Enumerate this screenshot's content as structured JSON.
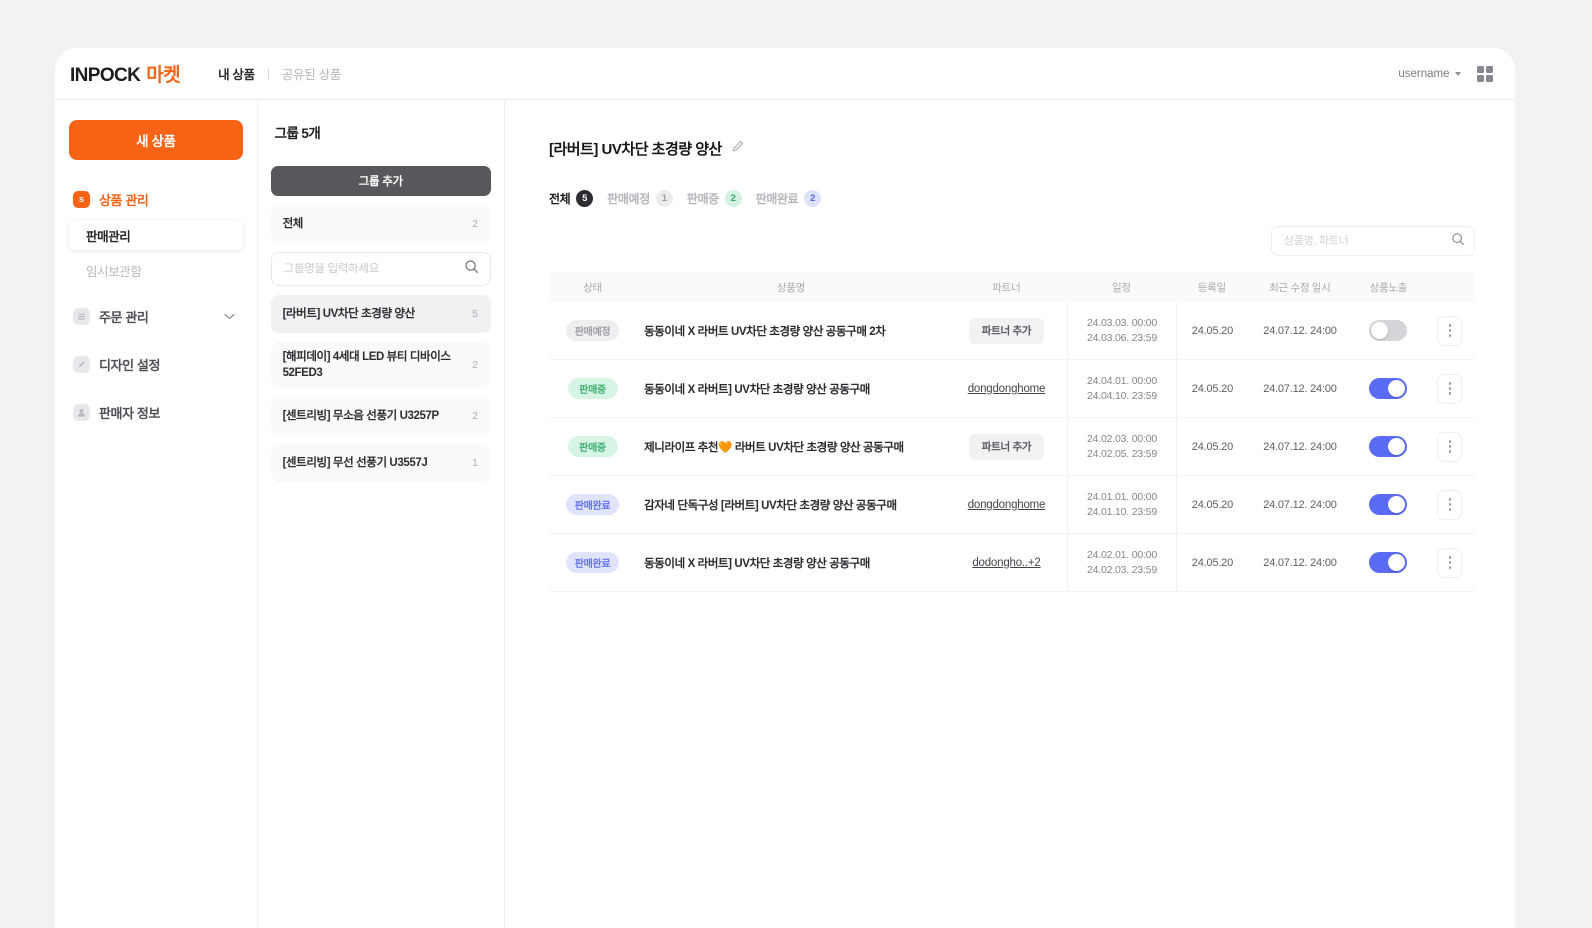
{
  "header": {
    "logo_main": "INPOCK",
    "logo_sub": "마켓",
    "nav": [
      {
        "label": "내 상품",
        "active": true
      },
      {
        "label": "공유된 상품",
        "active": false
      }
    ],
    "username": "username"
  },
  "sidebar": {
    "new_product_label": "새 상품",
    "items": [
      {
        "label": "상품 관리",
        "icon": "coin-icon",
        "active": true
      },
      {
        "label": "주문 관리",
        "icon": "list-icon",
        "active": false,
        "expandable": true
      },
      {
        "label": "디자인 설정",
        "icon": "brush-icon",
        "active": false
      },
      {
        "label": "판매자 정보",
        "icon": "person-icon",
        "active": false
      }
    ],
    "sub_items": [
      {
        "label": "판매관리",
        "selected": true
      },
      {
        "label": "임시보관함",
        "selected": false
      }
    ]
  },
  "groups": {
    "title": "그룹",
    "count_label": "5개",
    "add_button": "그룹 추가",
    "all_item": {
      "name": "전체",
      "count": "2"
    },
    "search_placeholder": "그룹명을 입력하세요",
    "search_value": "",
    "items": [
      {
        "name": "[라버트] UV차단 초경량 양산",
        "count": "5",
        "selected": true
      },
      {
        "name": "[해피데이] 4세대 LED 뷰티 디바이스 52FED3",
        "count": "2",
        "selected": false
      },
      {
        "name": "[센트리빙] 무소음 선풍기 U3257P",
        "count": "2",
        "selected": false
      },
      {
        "name": "[센트리빙] 무선 선풍기 U3557J",
        "count": "1",
        "selected": false
      }
    ]
  },
  "main": {
    "page_title": "[라버트] UV차단 초경량 양산",
    "tabs": [
      {
        "label": "전체",
        "count": "5",
        "style": "dark",
        "active": true
      },
      {
        "label": "판매예정",
        "count": "1",
        "style": "gray",
        "active": false
      },
      {
        "label": "판매중",
        "count": "2",
        "style": "green",
        "active": false
      },
      {
        "label": "판매완료",
        "count": "2",
        "style": "blue",
        "active": false
      }
    ],
    "search_placeholder": "상품명, 파트너",
    "search_value": "",
    "table": {
      "columns": [
        "상태",
        "상품명",
        "파트너",
        "일정",
        "등록일",
        "최근 수정 일시",
        "상품노출"
      ],
      "rows": [
        {
          "status": "판매예정",
          "status_style": "pending",
          "name": "동동이네 X 라버트 UV차단 초경량 양산 공동구매 2차",
          "partner_type": "button",
          "partner": "파트너 추가",
          "schedule_start": "24.03.03. 00:00",
          "schedule_end": "24.03.06. 23:59",
          "registered": "24.05.20",
          "modified": "24.07.12. 24:00",
          "exposed": false
        },
        {
          "status": "판매중",
          "status_style": "selling",
          "name": "동동이네 X 라버트] UV차단 초경량 양산 공동구매",
          "partner_type": "link",
          "partner": "dongdonghome",
          "schedule_start": "24.04.01. 00:00",
          "schedule_end": "24.04.10. 23:59",
          "registered": "24.05.20",
          "modified": "24.07.12. 24:00",
          "exposed": true
        },
        {
          "status": "판매중",
          "status_style": "selling",
          "name": "제니라이프 추천🧡 라버트 UV차단 초경량 양산 공동구매",
          "partner_type": "button",
          "partner": "파트너 추가",
          "schedule_start": "24.02.03. 00:00",
          "schedule_end": "24.02.05. 23:59",
          "registered": "24.05.20",
          "modified": "24.07.12. 24:00",
          "exposed": true
        },
        {
          "status": "판매완료",
          "status_style": "done",
          "name": "감자네 단독구성 [라버트] UV차단 초경량 양산 공동구매",
          "partner_type": "link",
          "partner": "dongdonghome",
          "schedule_start": "24.01.01. 00:00",
          "schedule_end": "24.01.10. 23:59",
          "registered": "24.05.20",
          "modified": "24.07.12. 24:00",
          "exposed": true
        },
        {
          "status": "판매완료",
          "status_style": "done",
          "name": "동동이네 X 라버트] UV차단 초경량 양산 공동구매",
          "partner_type": "link",
          "partner": "dodongho..+2",
          "schedule_start": "24.02.01. 00:00",
          "schedule_end": "24.02.03. 23:59",
          "registered": "24.05.20",
          "modified": "24.07.12. 24:00",
          "exposed": true
        }
      ]
    }
  },
  "colors": {
    "brand_orange": "#f96316",
    "toggle_on": "#5a6cf5",
    "badge_dark": "#2c2d31"
  }
}
